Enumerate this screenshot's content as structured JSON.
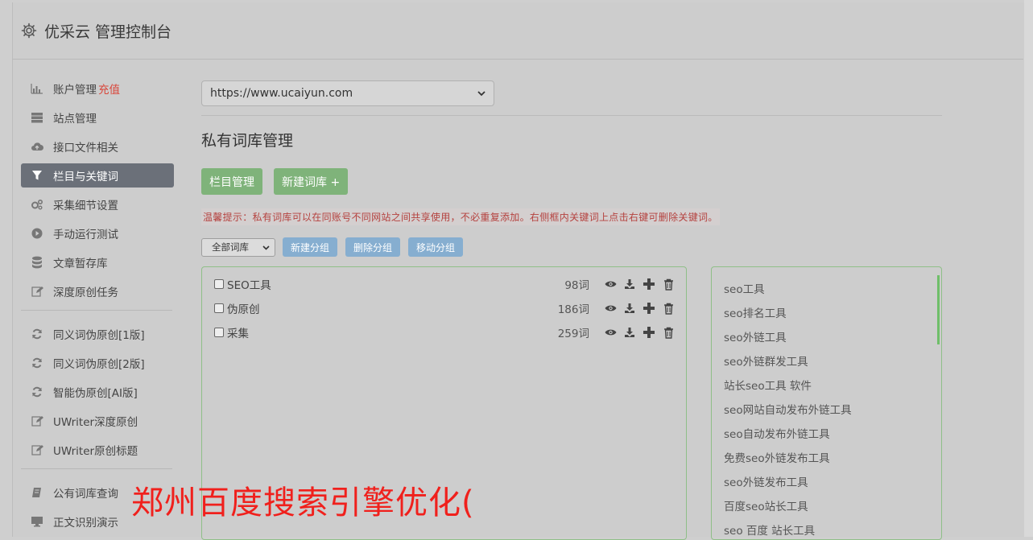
{
  "header": {
    "title": "优采云 管理控制台"
  },
  "sidebar": {
    "group1": [
      {
        "label": "账户管理",
        "badge": "充值",
        "icon": "chart-icon"
      },
      {
        "label": "站点管理",
        "icon": "server-icon"
      },
      {
        "label": "接口文件相关",
        "icon": "cloud-upload-icon"
      },
      {
        "label": "栏目与关键词",
        "icon": "filter-icon",
        "active": true
      },
      {
        "label": "采集细节设置",
        "icon": "gears-icon"
      },
      {
        "label": "手动运行测试",
        "icon": "play-circle-icon"
      },
      {
        "label": "文章暂存库",
        "icon": "database-icon"
      },
      {
        "label": "深度原创任务",
        "icon": "edit-icon"
      }
    ],
    "group2": [
      {
        "label": "同义词伪原创[1版]",
        "icon": "refresh-icon"
      },
      {
        "label": "同义词伪原创[2版]",
        "icon": "refresh-icon"
      },
      {
        "label": "智能伪原创[AI版]",
        "icon": "refresh-icon"
      },
      {
        "label": "UWriter深度原创",
        "icon": "edit-icon"
      },
      {
        "label": "UWriter原创标题",
        "icon": "edit-icon"
      }
    ],
    "group3": [
      {
        "label": "公有词库查询",
        "icon": "book-icon"
      },
      {
        "label": "正文识别演示",
        "icon": "monitor-icon"
      }
    ]
  },
  "main": {
    "site_select": "https://www.ucaiyun.com",
    "page_title": "私有词库管理",
    "buttons": {
      "column_manage": "栏目管理",
      "new_library": "新建词库 +"
    },
    "tip": "温馨提示：私有词库可以在同账号不同网站之间共享使用，不必重复添加。右侧框内关键词上点击右键可删除关键词。",
    "filter_select": "全部词库",
    "group_buttons": {
      "new_group": "新建分组",
      "delete_group": "删除分组",
      "move_group": "移动分组"
    },
    "libraries": [
      {
        "name": "SEO工具",
        "count": "98词"
      },
      {
        "name": "伪原创",
        "count": "186词"
      },
      {
        "name": "采集",
        "count": "259词"
      }
    ],
    "keywords": [
      "seo工具",
      "seo排名工具",
      "seo外链工具",
      "seo外链群发工具",
      "站长seo工具 软件",
      "seo网站自动发布外链工具",
      "seo自动发布外链工具",
      "免费seo外链发布工具",
      "seo外链发布工具",
      "百度seo站长工具",
      "seo 百度 站长工具"
    ]
  },
  "overlay_text": "郑州百度搜索引擎优化(",
  "colors": {
    "active_nav": "#6b7079",
    "green_button": "#7fb37a",
    "blue_button": "#86aed0",
    "overlay": "#f0201c",
    "badge": "#d9463b"
  }
}
